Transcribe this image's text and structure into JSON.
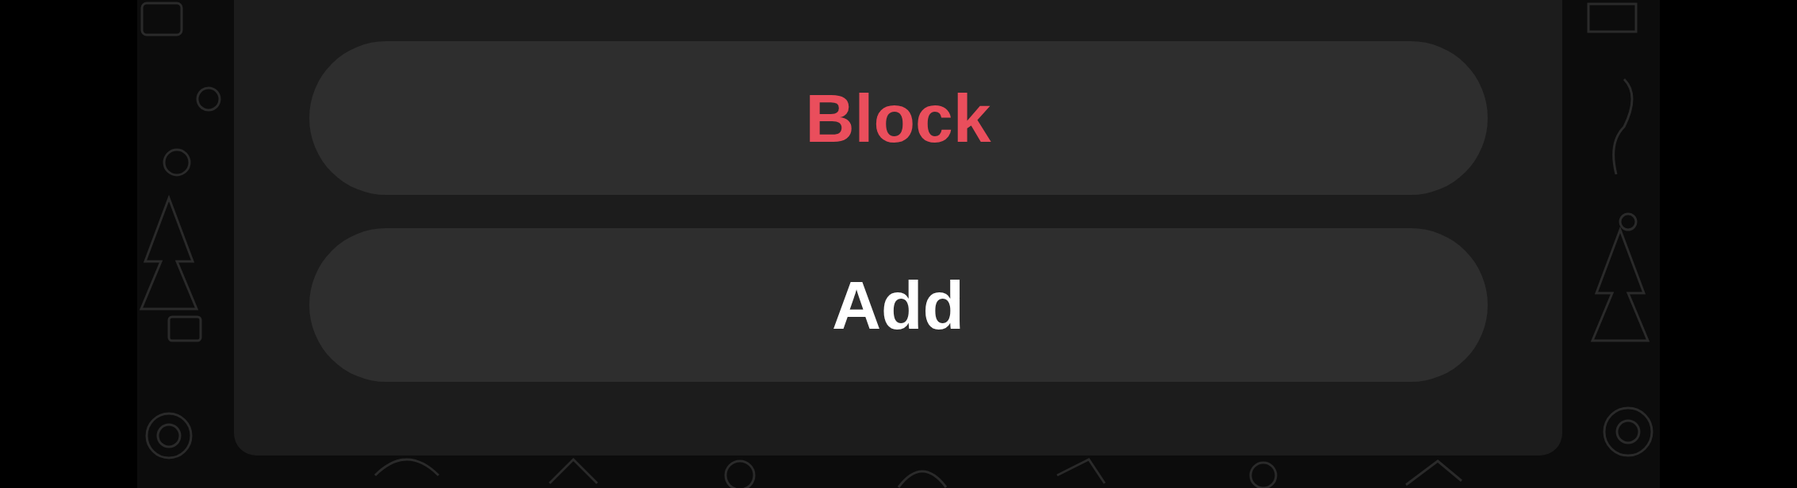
{
  "action_sheet": {
    "buttons": [
      {
        "label": "Block",
        "kind": "destructive"
      },
      {
        "label": "Add",
        "kind": "default"
      }
    ]
  }
}
